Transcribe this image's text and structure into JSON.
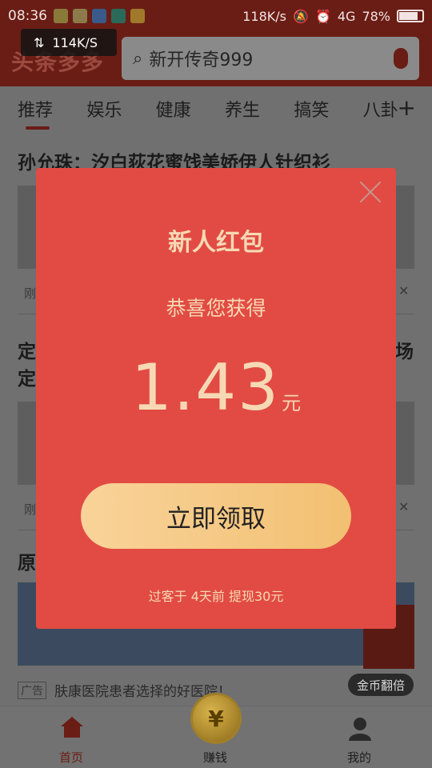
{
  "status_bar": {
    "time": "08:36",
    "net_speed": "118K/s",
    "network_type": "4G",
    "battery": "78%",
    "overlay_speed": "114K/S"
  },
  "header": {
    "logo_text": "头条多多",
    "search_placeholder": "新开传奇999"
  },
  "tabs": [
    "推荐",
    "娱乐",
    "健康",
    "养生",
    "搞笑",
    "八卦"
  ],
  "feed": {
    "headline_1": "孙允珠：汐白荻花蜜饯美娇伊人针织衫",
    "meta_1": "刚",
    "side_left_2": "定",
    "side_left_2b": "定",
    "side_right_2": "场",
    "meta_2": "刚",
    "side_left_3": "原",
    "ad_tag": "广告",
    "ad_text": "肤康医院患者选择的好医院！",
    "gold_badge": "金币翻倍"
  },
  "bottom_nav": {
    "home": "首页",
    "earn": "赚钱",
    "mine": "我的",
    "coin_symbol": "¥"
  },
  "modal": {
    "title": "新人红包",
    "subtitle": "恭喜您获得",
    "amount": "1.43",
    "unit": "元",
    "button": "立即领取",
    "footer": "过客于 4天前 提现30元"
  },
  "colors": {
    "modal_bg": "#e24b43",
    "modal_text": "#f6d9b4",
    "button_gradient_start": "#f9d39a",
    "button_gradient_end": "#f2c072"
  }
}
